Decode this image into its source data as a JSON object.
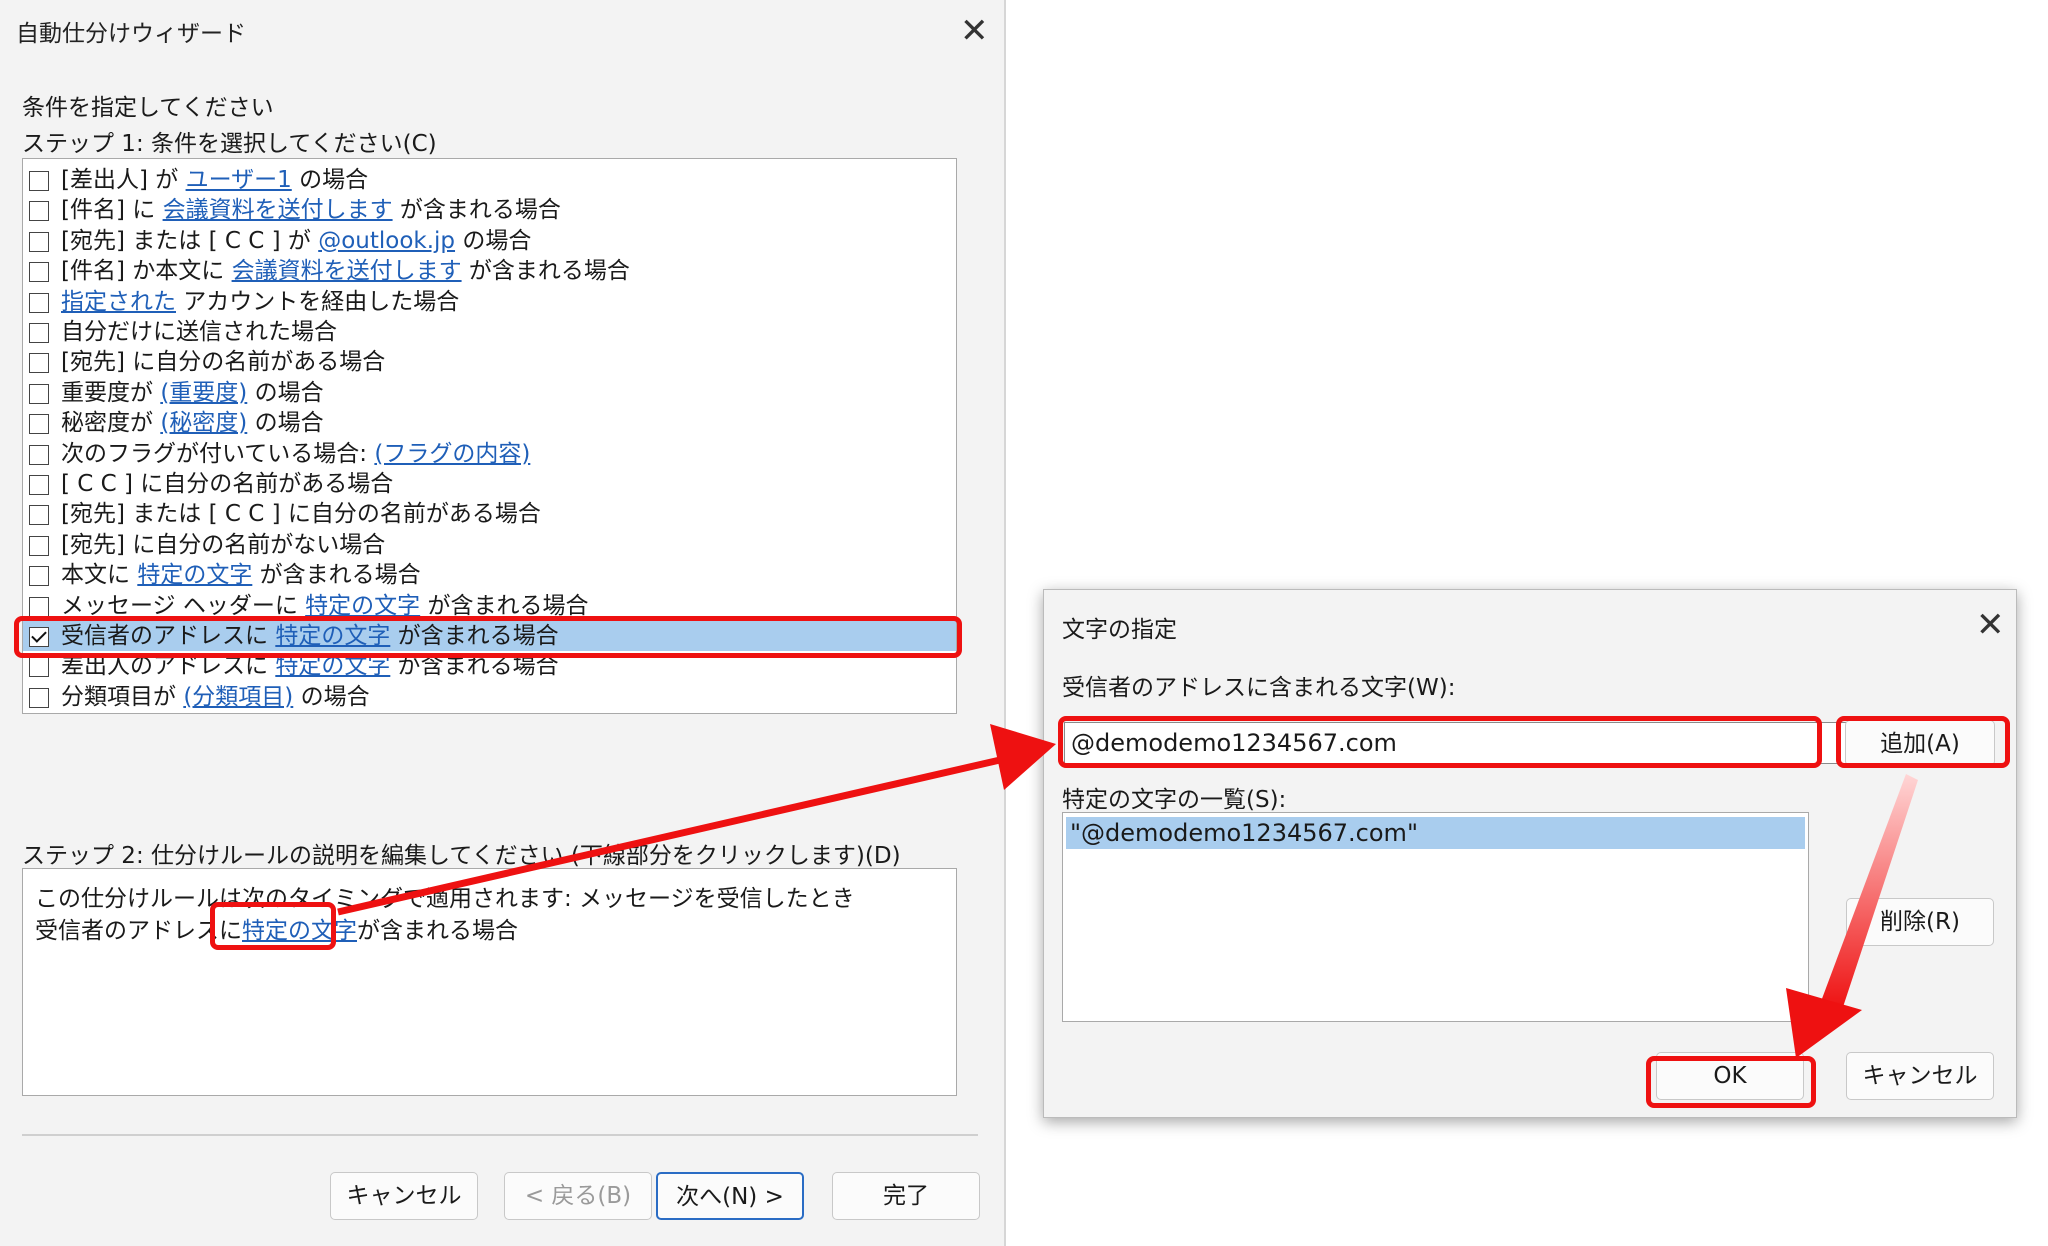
{
  "wizard": {
    "title": "自動仕分けウィザード",
    "close_glyph": "✕",
    "instruction": "条件を指定してください",
    "step1_label": "ステップ 1: 条件を選択してください(C)",
    "conditions": [
      {
        "checked": false,
        "pre": "[差出人] が ",
        "link": "ユーザー1",
        "post": " の場合"
      },
      {
        "checked": false,
        "pre": "[件名] に ",
        "link": "会議資料を送付します",
        "post": " が含まれる場合"
      },
      {
        "checked": false,
        "pre": "[宛先] または [ C C ] が ",
        "link": "@outlook.jp",
        "post": " の場合"
      },
      {
        "checked": false,
        "pre": "[件名] か本文に ",
        "link": "会議資料を送付します",
        "post": " が含まれる場合"
      },
      {
        "checked": false,
        "pre": "",
        "link": "指定された",
        "post": " アカウントを経由した場合"
      },
      {
        "checked": false,
        "pre": "自分だけに送信された場合",
        "link": "",
        "post": ""
      },
      {
        "checked": false,
        "pre": "[宛先] に自分の名前がある場合",
        "link": "",
        "post": ""
      },
      {
        "checked": false,
        "pre": "重要度が ",
        "link": "(重要度)",
        "post": " の場合"
      },
      {
        "checked": false,
        "pre": "秘密度が ",
        "link": "(秘密度)",
        "post": " の場合"
      },
      {
        "checked": false,
        "pre": "次のフラグが付いている場合: ",
        "link": "(フラグの内容)",
        "post": ""
      },
      {
        "checked": false,
        "pre": "[ C C ] に自分の名前がある場合",
        "link": "",
        "post": ""
      },
      {
        "checked": false,
        "pre": "[宛先] または [ C C ] に自分の名前がある場合",
        "link": "",
        "post": ""
      },
      {
        "checked": false,
        "pre": "[宛先] に自分の名前がない場合",
        "link": "",
        "post": ""
      },
      {
        "checked": false,
        "pre": "本文に ",
        "link": "特定の文字",
        "post": " が含まれる場合"
      },
      {
        "checked": false,
        "pre": "メッセージ ヘッダーに ",
        "link": "特定の文字",
        "post": " が含まれる場合"
      },
      {
        "checked": true,
        "pre": "受信者のアドレスに ",
        "link": "特定の文字",
        "post": " が含まれる場合"
      },
      {
        "checked": false,
        "pre": "差出人のアドレスに ",
        "link": "特定の文字",
        "post": " が含まれる場合"
      },
      {
        "checked": false,
        "pre": "分類項目が ",
        "link": "(分類項目)",
        "post": " の場合"
      }
    ],
    "step2_label": "ステップ 2: 仕分けルールの説明を編集してください (下線部分をクリックします)(D)",
    "desc_line1": "この仕分けルールは次のタイミングで適用されます: メッセージを受信したとき",
    "desc_line2_pre": "受信者のアドレスに",
    "desc_line2_link": "特定の文字",
    "desc_line2_post": "が含まれる場合",
    "buttons": {
      "cancel": "キャンセル",
      "back": "< 戻る(B)",
      "next": "次へ(N) >",
      "finish": "完了"
    }
  },
  "dialog": {
    "title": "文字の指定",
    "close_glyph": "✕",
    "input_label": "受信者のアドレスに含まれる文字(W):",
    "input_value": "@demodemo1234567.com",
    "add_button": "追加(A)",
    "list_label": "特定の文字の一覧(S):",
    "list_items": [
      "\"@demodemo1234567.com\""
    ],
    "delete_button": "削除(R)",
    "ok_button": "OK",
    "cancel_button": "キャンセル"
  },
  "colors": {
    "highlight": "#ee1111",
    "link": "#1f5fb8",
    "selection": "#a9cdee"
  }
}
